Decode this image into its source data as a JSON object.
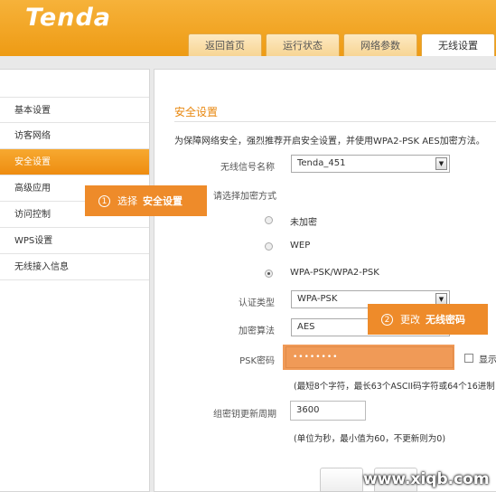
{
  "app": {
    "logo": "Tenda"
  },
  "tabs": [
    {
      "label": "返回首页"
    },
    {
      "label": "运行状态"
    },
    {
      "label": "网络参数"
    },
    {
      "label": "无线设置",
      "active": true
    }
  ],
  "sidebar": {
    "items": [
      {
        "label": "基本设置"
      },
      {
        "label": "访客网络"
      },
      {
        "label": "安全设置",
        "active": true
      },
      {
        "label": "高级应用"
      },
      {
        "label": "访问控制"
      },
      {
        "label": "WPS设置"
      },
      {
        "label": "无线接入信息"
      }
    ]
  },
  "form": {
    "section_title": "安全设置",
    "description": "为保障网络安全，强烈推荐开启安全设置，并使用WPA2-PSK AES加密方法。",
    "ssid_label": "无线信号名称",
    "ssid_value": "Tenda_451",
    "encryption_prompt": "请选择加密方式",
    "encryption_options": [
      {
        "label": "未加密",
        "checked": false
      },
      {
        "label": "WEP",
        "checked": false
      },
      {
        "label": "WPA-PSK/WPA2-PSK",
        "checked": true
      }
    ],
    "auth_label": "认证类型",
    "auth_value": "WPA-PSK",
    "cipher_label": "加密算法",
    "cipher_value": "AES",
    "psk_label": "PSK密码",
    "psk_value": "••••••••",
    "show_label": "显示",
    "psk_hint": "(最短8个字符，最长63个ASCII码字符或64个16进制",
    "rekey_label": "组密钥更新周期",
    "rekey_value": "3600",
    "rekey_hint": "(单位为秒，最小值为60，不更新则为0)"
  },
  "callouts": {
    "step1": {
      "num": "1",
      "text": "选择",
      "bold": "安全设置"
    },
    "step2": {
      "num": "2",
      "text": "更改",
      "bold": "无线密码"
    }
  },
  "watermark": "www.xiqb.com",
  "colors": {
    "accent": "#ee9b14",
    "callout": "#ee8b2a"
  }
}
